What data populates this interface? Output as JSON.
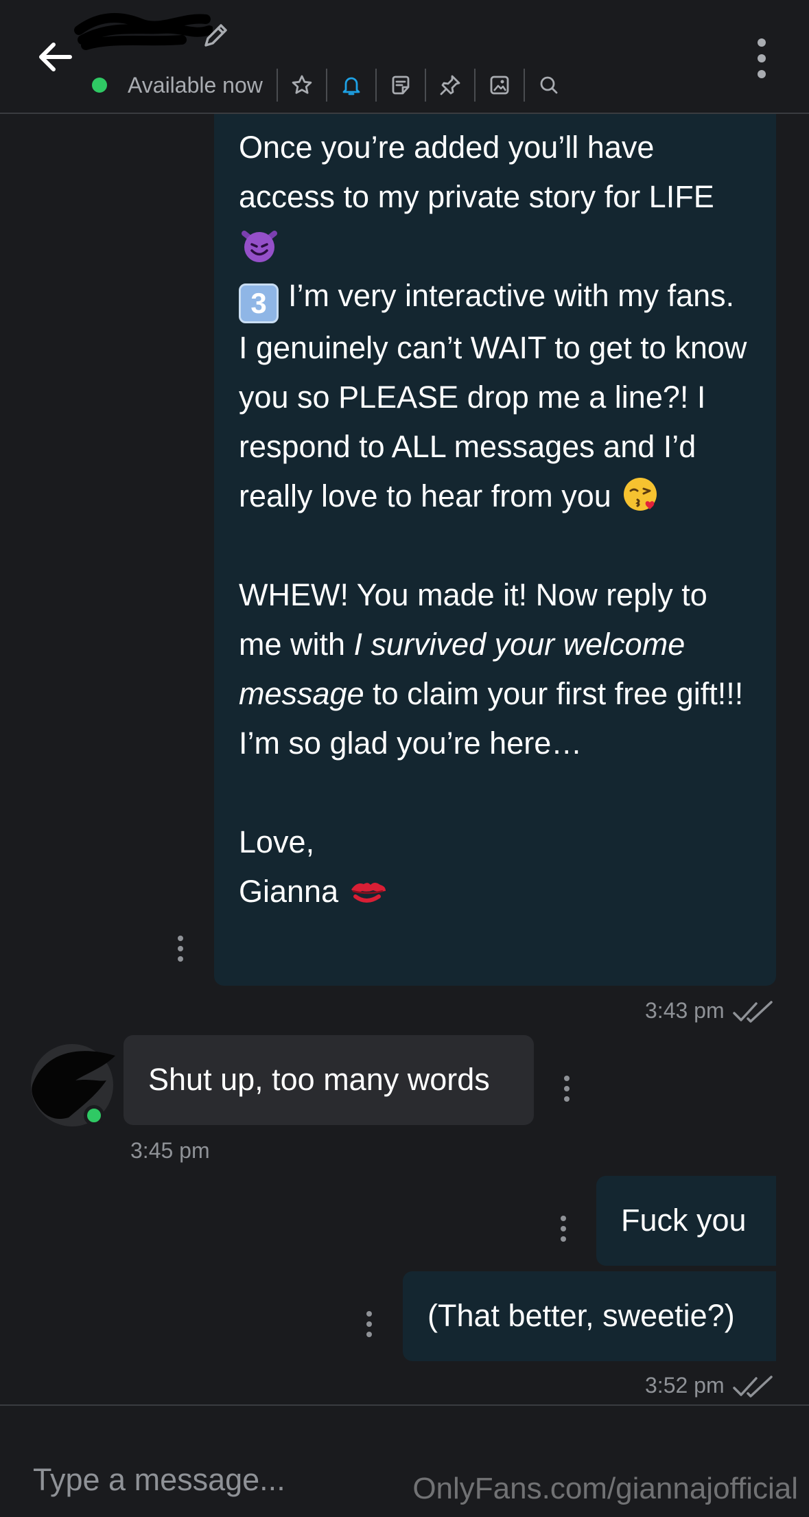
{
  "header": {
    "status": "Available now",
    "icons": [
      "back-arrow-icon",
      "edit-pencil-icon",
      "star-icon",
      "bell-icon",
      "note-icon",
      "pin-icon",
      "image-icon",
      "search-icon",
      "more-vertical-icon"
    ],
    "colors": {
      "online": "#2fc964",
      "bell_active": "#1ea2e6",
      "outgoing_bubble": "#142630",
      "incoming_bubble": "#2a2b2f"
    }
  },
  "messages": {
    "m1": {
      "p1_line1": "Once you’re added you’ll have",
      "p1_line2": "access to my private story for LIFE",
      "p2_keycap": "3",
      "p2_text": "I’m very interactive with my fans. I genuinely can’t WAIT to get to know you so PLEASE drop me a line?! I respond to ALL messages and I’d really love to hear from you",
      "p3_a": "WHEW! You made it! Now reply to me with ",
      "p3_italic": "I survived your welcome message",
      "p3_b": " to claim your first free gift!!! I’m so glad you’re here…",
      "sign_love": "Love,",
      "sign_name": "Gianna",
      "time": "3:43 pm"
    },
    "m2": {
      "text": "Shut up, too many words",
      "time": "3:45 pm"
    },
    "m3": {
      "text": "Fuck you"
    },
    "m4": {
      "text": "(That better, sweetie?)",
      "time": "3:52 pm"
    }
  },
  "composer": {
    "placeholder": "Type a message..."
  },
  "watermark": "OnlyFans.com/giannajofficial"
}
